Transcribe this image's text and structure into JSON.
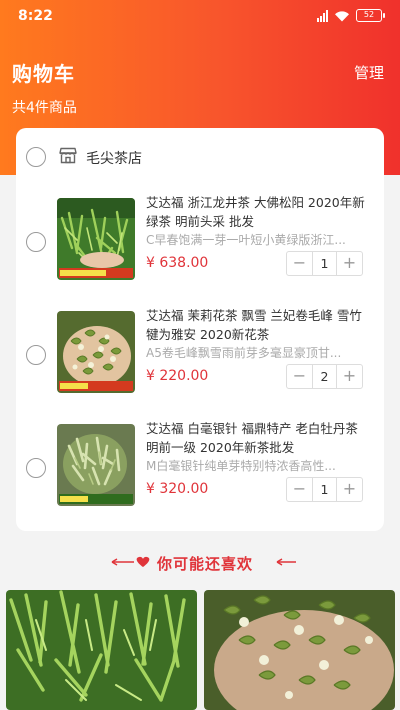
{
  "status_bar": {
    "time": "8:22",
    "battery": "52"
  },
  "header": {
    "title": "购物车",
    "manage_label": "管理",
    "item_count": "共4件商品"
  },
  "shop": {
    "name": "毛尖茶店",
    "icon": "store-icon"
  },
  "products": [
    {
      "name": "艾达福  浙江龙井茶 大佛松阳 2020年新绿茶 明前头采 批发",
      "desc": "C早春饱满一芽一叶短小黄绿版浙江...",
      "price": "¥ 638.00",
      "qty": "1",
      "image": "tea-leaves-photo"
    },
    {
      "name": "艾达福 茉莉花茶 飘雪 兰妃卷毛峰 雪竹 犍为雅安 2020新花茶",
      "desc": "A5卷毛峰飘雪雨前芽多毫显豪顶甘...",
      "price": "¥ 220.00",
      "qty": "2",
      "image": "jasmine-tea-photo"
    },
    {
      "name": "艾达福 白毫银针 福鼎特产 老白牡丹茶 明前一级 2020年新茶批发",
      "desc": "M白毫银针纯单芽特别特浓香高性...",
      "price": "¥ 320.00",
      "qty": "1",
      "image": "white-tea-photo"
    }
  ],
  "stepper": {
    "minus": "−",
    "plus": "+"
  },
  "recommend": {
    "title": "你可能还喜欢"
  },
  "colors": {
    "header_start": "#ff7a1e",
    "header_end": "#f0312c",
    "price": "#e0343a",
    "accent": "#e0343a"
  }
}
